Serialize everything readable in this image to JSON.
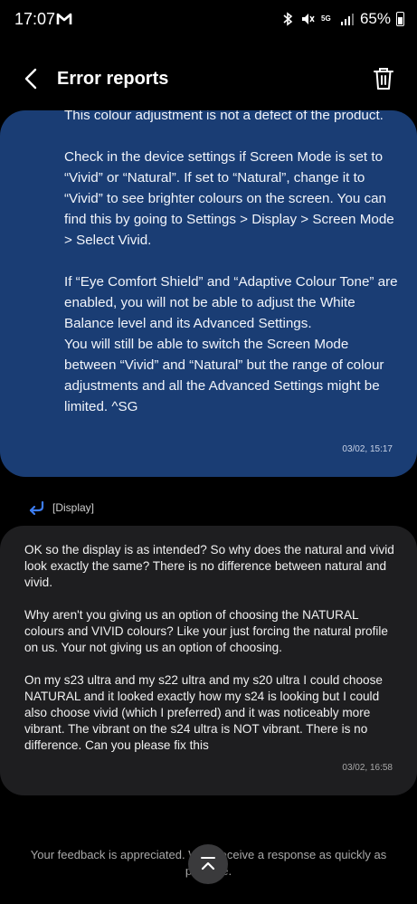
{
  "status_bar": {
    "time": "17:07",
    "battery": "65%",
    "icons": [
      "gmail-icon",
      "bluetooth-icon",
      "mute-icon",
      "5g-icon",
      "signal-icon",
      "battery-icon"
    ]
  },
  "header": {
    "title": "Error reports",
    "back_icon": "back-arrow-icon",
    "delete_icon": "trash-icon"
  },
  "reply": {
    "text": "This colour adjustment is not a defect of the product.\n\nCheck in the device settings if Screen Mode is set to “Vivid” or “Natural”. If set to “Natural”, change it to “Vivid” to see brighter colours on the screen. You can find this by going to Settings > Display > Screen Mode > Select Vivid.\n\nIf “Eye Comfort Shield” and “Adaptive Colour Tone” are enabled, you will not be able to adjust the White Balance level and its Advanced Settings.\nYou will still be able to switch the Screen Mode between “Vivid” and “Natural” but the range of colour adjustments and all the Advanced Settings might be limited. ^SG",
    "timestamp": "03/02, 15:17"
  },
  "category": {
    "label": "[Display]"
  },
  "message": {
    "text": "OK so the display is as intended? So why does the  natural and vivid look exactly the same? There is no difference between natural and vivid.\n\nWhy aren't you giving us an option of choosing the NATURAL colours and VIVID colours? Like your just forcing the natural profile on us. Your not giving us an option of choosing.\n\nOn my s23 ultra and my s22 ultra and my s20 ultra I could choose NATURAL and it looked exactly how my s24 is looking but I could also choose vivid (which I preferred) and it was noticeably more vibrant. The vibrant on the s24 ultra is NOT vibrant. There is no difference. Can you please fix this",
    "timestamp": "03/02, 16:58"
  },
  "footer": {
    "text": "Your feedback is appreciated. We'll receive a response as quickly as possible."
  },
  "colors": {
    "reply_bubble": "#1a3d74",
    "message_bubble": "#1e1e20",
    "tag_arrow": "#3d7df2"
  }
}
